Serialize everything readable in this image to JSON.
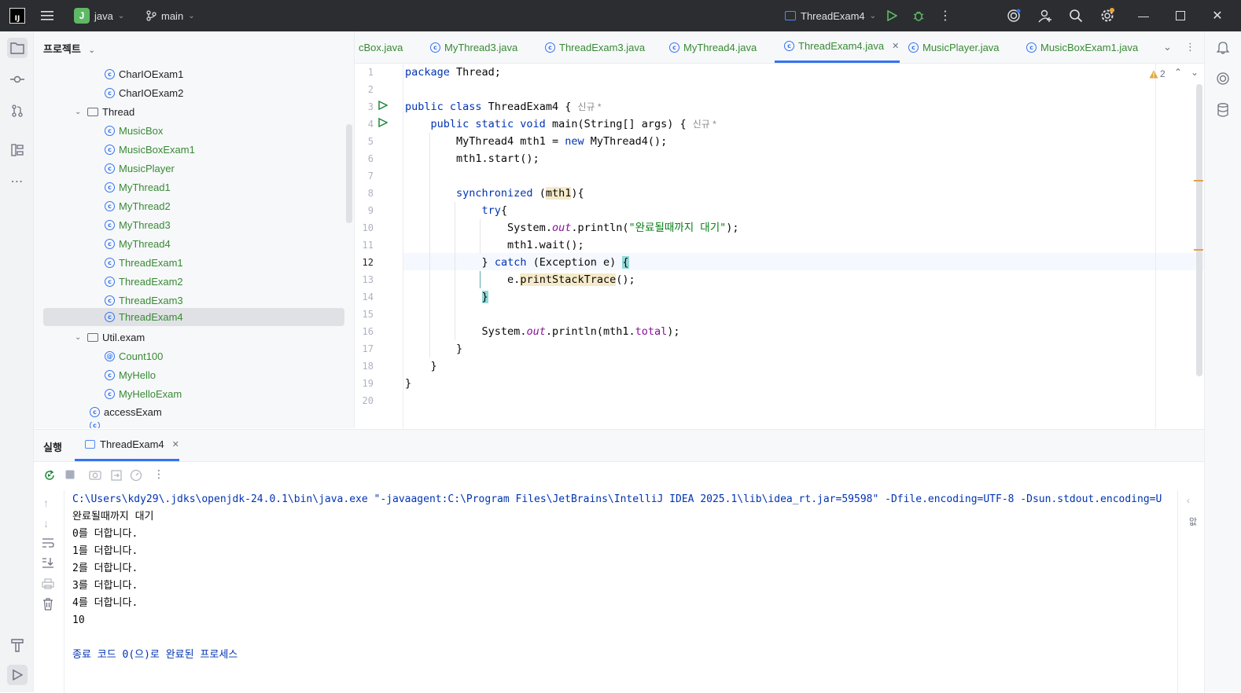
{
  "titlebar": {
    "logo": "IJ",
    "project_badge": "J",
    "project_name": "java",
    "branch_icon": "git-branch-icon",
    "branch": "main",
    "run_config": "ThreadExam4",
    "notification_color": "#f0a732"
  },
  "project_panel": {
    "title": "프로젝트",
    "items": [
      {
        "label": "CharIOExam1",
        "icon": "class-main-icon"
      },
      {
        "label": "CharIOExam2",
        "icon": "class-main-icon"
      },
      {
        "label": "Thread",
        "icon": "package-icon"
      },
      {
        "label": "MusicBox",
        "icon": "class-icon"
      },
      {
        "label": "MusicBoxExam1",
        "icon": "class-main-icon"
      },
      {
        "label": "MusicPlayer",
        "icon": "class-icon"
      },
      {
        "label": "MyThread1",
        "icon": "class-icon"
      },
      {
        "label": "MyThread2",
        "icon": "class-icon"
      },
      {
        "label": "MyThread3",
        "icon": "class-icon"
      },
      {
        "label": "MyThread4",
        "icon": "class-icon"
      },
      {
        "label": "ThreadExam1",
        "icon": "class-main-icon"
      },
      {
        "label": "ThreadExam2",
        "icon": "class-main-icon"
      },
      {
        "label": "ThreadExam3",
        "icon": "class-main-icon"
      },
      {
        "label": "ThreadExam4",
        "icon": "class-main-icon"
      },
      {
        "label": "Util.exam",
        "icon": "package-icon"
      },
      {
        "label": "Count100",
        "icon": "annotation-icon"
      },
      {
        "label": "MyHello",
        "icon": "class-icon"
      },
      {
        "label": "MyHelloExam",
        "icon": "class-main-icon"
      },
      {
        "label": "accessExam",
        "icon": "class-main-icon"
      }
    ]
  },
  "tabs": [
    {
      "label": "cBox.java"
    },
    {
      "label": "MyThread3.java"
    },
    {
      "label": "ThreadExam3.java"
    },
    {
      "label": "MyThread4.java"
    },
    {
      "label": "ThreadExam4.java",
      "active": true
    },
    {
      "label": "MusicPlayer.java"
    },
    {
      "label": "MusicBoxExam1.java"
    }
  ],
  "editor": {
    "warning_count": "2",
    "line_numbers": [
      "1",
      "2",
      "3",
      "4",
      "5",
      "6",
      "7",
      "8",
      "9",
      "10",
      "11",
      "12",
      "13",
      "14",
      "15",
      "16",
      "17",
      "18",
      "19",
      "20"
    ],
    "hint_new": "신규 *",
    "code": {
      "l1_kw": "package",
      "l1_rest": " Thread;",
      "l3_kw": "public class",
      "l3_rest": " ThreadExam4 { ",
      "l4_kw1": "public static void",
      "l4_rest": " main(String[] args) { ",
      "l5_a": "MyThread4 mth1 = ",
      "l5_kw": "new",
      "l5_b": " MyThread4();",
      "l6": "mth1.start();",
      "l8_kw": "synchronized",
      "l8_a": " (",
      "l8_var": "mth1",
      "l8_b": "){",
      "l9_kw": "try",
      "l9_b": "{",
      "l10_a": "System.",
      "l10_out": "out",
      "l10_b": ".println(",
      "l10_str": "\"완료될때까지 대기\"",
      "l10_c": ");",
      "l11": "mth1.wait();",
      "l12_a": "} ",
      "l12_kw": "catch",
      "l12_b": " (Exception e) ",
      "l12_brace": "{",
      "l13_a": "e.",
      "l13_call": "printStackTrace",
      "l13_b": "();",
      "l14_brace": "}",
      "l16_a": "System.",
      "l16_out": "out",
      "l16_b": ".println(mth1.",
      "l16_fld": "total",
      "l16_c": ");",
      "l17": "}",
      "l18": "}",
      "l19": "}"
    }
  },
  "run_panel": {
    "title": "실행",
    "tab": "ThreadExam4",
    "side_label": "앖",
    "console": {
      "command": "C:\\Users\\kdy29\\.jdks\\openjdk-24.0.1\\bin\\java.exe \"-javaagent:C:\\Program Files\\JetBrains\\IntelliJ IDEA 2025.1\\lib\\idea_rt.jar=59598\" -Dfile.encoding=UTF-8 -Dsun.stdout.encoding=U",
      "lines": [
        "완료될때까지 대기",
        "0를 더합니다.",
        "1를 더합니다.",
        "2를 더합니다.",
        "3를 더합니다.",
        "4를 더합니다.",
        "10",
        ""
      ],
      "exit": "종료 코드 0(으)로 완료된 프로세스"
    }
  }
}
